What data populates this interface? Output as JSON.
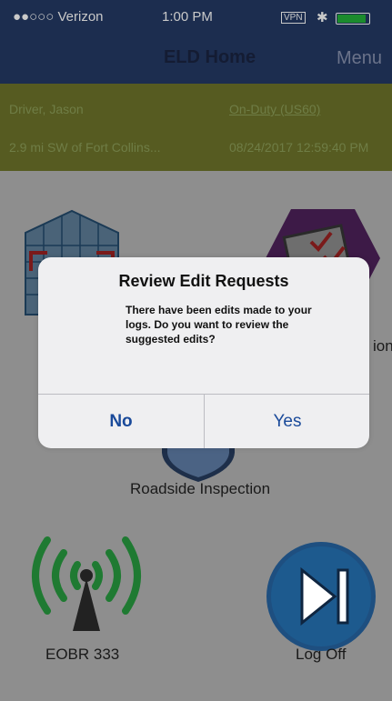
{
  "status": {
    "carrier": "●●○○○ Verizon",
    "time": "1:00 PM",
    "vpn": "VPN",
    "bluetooth": "✱"
  },
  "nav": {
    "title": "ELD Home",
    "menu": "Menu"
  },
  "info": {
    "driver": "Driver, Jason",
    "duty_status": "On-Duty (US60)",
    "location": "2.9 mi SW of Fort Collins...",
    "datetime": "08/24/2017 12:59:40 PM"
  },
  "tiles": [
    {
      "label": "",
      "icon": "building-grid-icon"
    },
    {
      "label": "ion",
      "icon": "dvir-checklist-icon"
    },
    {
      "label": "Roadside Inspection",
      "icon": "shield-icon"
    },
    {
      "label": "EOBR 333",
      "icon": "wireless-tower-icon"
    },
    {
      "label": "Log Off",
      "icon": "skip-forward-icon"
    }
  ],
  "dialog": {
    "title": "Review Edit Requests",
    "message": "There have been edits made to your logs.  Do you want to review the suggested edits?",
    "no_label": "No",
    "yes_label": "Yes"
  },
  "colors": {
    "navbar": "#1c2d4f",
    "infobar": "#565b21",
    "accent_blue": "#1a4a9a",
    "green": "#1f7a32"
  }
}
